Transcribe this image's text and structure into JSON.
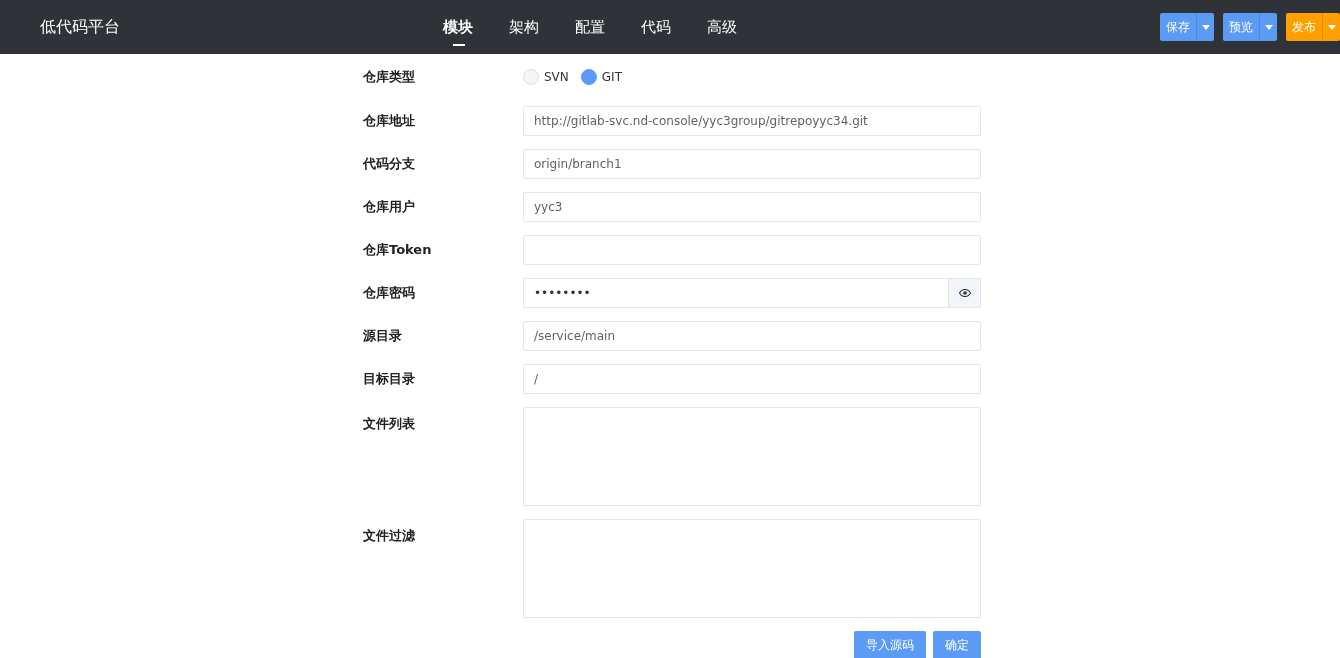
{
  "header": {
    "title": "低代码平台",
    "tabs": [
      {
        "label": "模块",
        "selected": true
      },
      {
        "label": "架构",
        "selected": false
      },
      {
        "label": "配置",
        "selected": false
      },
      {
        "label": "代码",
        "selected": false
      },
      {
        "label": "高级",
        "selected": false
      }
    ],
    "actions": [
      {
        "label": "保存",
        "color": "#5b9bf5"
      },
      {
        "label": "预览",
        "color": "#5b9bf5"
      },
      {
        "label": "发布",
        "color": "#ff9f00"
      }
    ]
  },
  "form": {
    "fields": [
      {
        "kind": "radio",
        "label": "仓库类型",
        "options": [
          {
            "label": "SVN",
            "selected": false
          },
          {
            "label": "GIT",
            "selected": true
          }
        ]
      },
      {
        "kind": "text",
        "label": "仓库地址",
        "value": "http://gitlab-svc.nd-console/yyc3group/gitrepoyyc34.git"
      },
      {
        "kind": "text",
        "label": "代码分支",
        "value": "origin/branch1"
      },
      {
        "kind": "text",
        "label": "仓库用户",
        "value": "yyc3"
      },
      {
        "kind": "text",
        "label": "仓库Token"
      },
      {
        "kind": "password",
        "label": "仓库密码",
        "value": "••••••••"
      },
      {
        "kind": "text",
        "label": "源目录",
        "value": "/service/main"
      },
      {
        "kind": "text",
        "label": "目标目录",
        "value": "/"
      },
      {
        "kind": "textarea",
        "label": "文件列表"
      },
      {
        "kind": "textarea",
        "label": "文件过滤"
      }
    ],
    "buttons": [
      "导入源码",
      "确定"
    ]
  }
}
